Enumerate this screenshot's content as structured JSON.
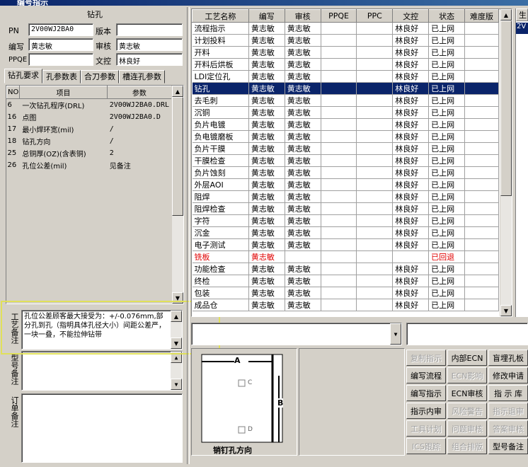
{
  "window": {
    "title": "编号指示"
  },
  "left_panel": {
    "header": "钻孔",
    "fields": {
      "pn_label": "PN",
      "pn_value": "2V00WJ2BA0",
      "version_label": "版本",
      "version_value": "",
      "writer_label": "编写",
      "writer_value": "黄志敏",
      "reviewer_label": "审核",
      "reviewer_value": "黄志敏",
      "ppqe_label": "PPQE",
      "ppqe_value": "",
      "doc_control_label": "文控",
      "doc_control_value": "林良好"
    },
    "tabs": [
      "钻孔要求",
      "孔参数表",
      "合刀参数",
      "槽连孔参数"
    ],
    "param_table": {
      "columns": [
        "NO",
        "项目",
        "参数"
      ],
      "rows": [
        [
          "6",
          "一次钻孔程序(DRL)",
          "2V00WJ2BA0.DRL"
        ],
        [
          "16",
          "点图",
          "2V00WJ2BA0.D"
        ],
        [
          "17",
          "最小焊环宽(mil)",
          "/"
        ],
        [
          "18",
          "钻孔方向",
          "/"
        ],
        [
          "25",
          "总铜厚(OZ)(含表铜)",
          "2"
        ],
        [
          "26",
          "孔位公差(mil)",
          "见备注"
        ]
      ]
    },
    "process_remark_label": "工艺备注",
    "process_remark_text": "孔位公差顾客最大接受为：+/-0.076mm,部分孔到孔（指明具体孔径大小）间距公差严，一块一叠，不能拉伸钻带",
    "model_remark_label": "型号备注",
    "order_remark_label": "订单备注"
  },
  "process_table": {
    "columns": [
      "工艺名称",
      "编写",
      "审核",
      "PPQE",
      "PPC",
      "文控",
      "状态",
      "难度版"
    ],
    "rows": [
      [
        "流程指示",
        "黄志敏",
        "黄志敏",
        "",
        "",
        "林良好",
        "已上网",
        ""
      ],
      [
        "计划投料",
        "黄志敏",
        "黄志敏",
        "",
        "",
        "林良好",
        "已上网",
        ""
      ],
      [
        "开料",
        "黄志敏",
        "黄志敏",
        "",
        "",
        "林良好",
        "已上网",
        ""
      ],
      [
        "开料后烘板",
        "黄志敏",
        "黄志敏",
        "",
        "",
        "林良好",
        "已上网",
        ""
      ],
      [
        "LDI定位孔",
        "黄志敏",
        "黄志敏",
        "",
        "",
        "林良好",
        "已上网",
        ""
      ],
      [
        "钻孔",
        "黄志敏",
        "黄志敏",
        "",
        "",
        "林良好",
        "已上网",
        ""
      ],
      [
        "去毛刺",
        "黄志敏",
        "黄志敏",
        "",
        "",
        "林良好",
        "已上网",
        ""
      ],
      [
        "沉铜",
        "黄志敏",
        "黄志敏",
        "",
        "",
        "林良好",
        "已上网",
        ""
      ],
      [
        "负片电镀",
        "黄志敏",
        "黄志敏",
        "",
        "",
        "林良好",
        "已上网",
        ""
      ],
      [
        "负电镀磨板",
        "黄志敏",
        "黄志敏",
        "",
        "",
        "林良好",
        "已上网",
        ""
      ],
      [
        "负片干膜",
        "黄志敏",
        "黄志敏",
        "",
        "",
        "林良好",
        "已上网",
        ""
      ],
      [
        "干膜检查",
        "黄志敏",
        "黄志敏",
        "",
        "",
        "林良好",
        "已上网",
        ""
      ],
      [
        "负片蚀刻",
        "黄志敏",
        "黄志敏",
        "",
        "",
        "林良好",
        "已上网",
        ""
      ],
      [
        "外层AOI",
        "黄志敏",
        "黄志敏",
        "",
        "",
        "林良好",
        "已上网",
        ""
      ],
      [
        "阻焊",
        "黄志敏",
        "黄志敏",
        "",
        "",
        "林良好",
        "已上网",
        ""
      ],
      [
        "阻焊检查",
        "黄志敏",
        "黄志敏",
        "",
        "",
        "林良好",
        "已上网",
        ""
      ],
      [
        "字符",
        "黄志敏",
        "黄志敏",
        "",
        "",
        "林良好",
        "已上网",
        ""
      ],
      [
        "沉金",
        "黄志敏",
        "黄志敏",
        "",
        "",
        "林良好",
        "已上网",
        ""
      ],
      [
        "电子测试",
        "黄志敏",
        "黄志敏",
        "",
        "",
        "林良好",
        "已上网",
        ""
      ],
      [
        "铣板",
        "黄志敏",
        "",
        "",
        "",
        "",
        "已回退",
        ""
      ],
      [
        "功能检查",
        "黄志敏",
        "黄志敏",
        "",
        "",
        "林良好",
        "已上网",
        ""
      ],
      [
        "终检",
        "黄志敏",
        "黄志敏",
        "",
        "",
        "林良好",
        "已上网",
        ""
      ],
      [
        "包装",
        "黄志敏",
        "黄志敏",
        "",
        "",
        "林良好",
        "已上网",
        ""
      ],
      [
        "成品仓",
        "黄志敏",
        "黄志敏",
        "",
        "",
        "林良好",
        "已上网",
        ""
      ]
    ],
    "selected_row": 5,
    "returned_row": 19,
    "returned_color": "#e00000"
  },
  "far_right": {
    "header": "生",
    "value": "2V"
  },
  "diagram": {
    "label_a": "A",
    "label_b": "B",
    "label_c": "C",
    "label_d": "D",
    "caption": "销钉孔方向"
  },
  "buttons": [
    {
      "label": "复制指示",
      "enabled": false
    },
    {
      "label": "内部ECN",
      "enabled": true
    },
    {
      "label": "盲埋孔板",
      "enabled": true
    },
    {
      "label": "编写流程",
      "enabled": true
    },
    {
      "label": "ECN影响",
      "enabled": false
    },
    {
      "label": "修改申请",
      "enabled": true
    },
    {
      "label": "编写指示",
      "enabled": true
    },
    {
      "label": "ECN审核",
      "enabled": true
    },
    {
      "label": "指 示 库",
      "enabled": true
    },
    {
      "label": "指示内审",
      "enabled": true
    },
    {
      "label": "风险警告",
      "enabled": false
    },
    {
      "label": "指示退审",
      "enabled": false
    },
    {
      "label": "工具计划",
      "enabled": false
    },
    {
      "label": "问题审核",
      "enabled": false
    },
    {
      "label": "答案审核",
      "enabled": false
    },
    {
      "label": "ICS跟踪",
      "enabled": false
    },
    {
      "label": "组合排版",
      "enabled": false
    },
    {
      "label": "型号备注",
      "enabled": true
    }
  ],
  "colors": {
    "selection": "#0a246a",
    "highlight_box": "#e0e05a"
  }
}
